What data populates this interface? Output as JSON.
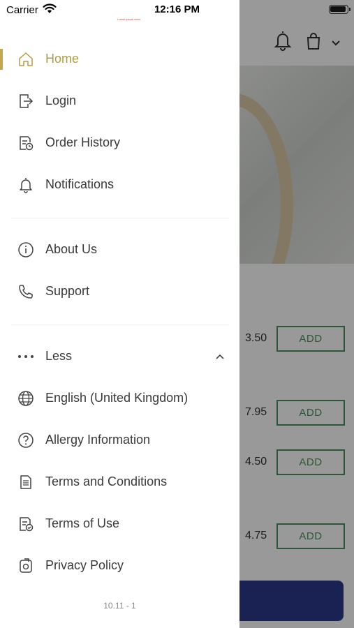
{
  "status_bar": {
    "carrier": "Carrier",
    "time": "12:16 PM"
  },
  "drawer": {
    "note": "Lorem ipsum dolor",
    "primary_items": [
      {
        "label": "Home",
        "icon": "home-icon",
        "active": true
      },
      {
        "label": "Login",
        "icon": "login-icon"
      },
      {
        "label": "Order History",
        "icon": "order-history-icon"
      },
      {
        "label": "Notifications",
        "icon": "bell-icon"
      }
    ],
    "secondary_items": [
      {
        "label": "About Us",
        "icon": "info-icon"
      },
      {
        "label": "Support",
        "icon": "phone-icon"
      }
    ],
    "toggle": {
      "label": "Less",
      "icon": "ellipsis-icon"
    },
    "more_items": [
      {
        "label": "English (United Kingdom)",
        "icon": "globe-icon"
      },
      {
        "label": "Allergy Information",
        "icon": "question-icon"
      },
      {
        "label": "Terms and Conditions",
        "icon": "document-icon"
      },
      {
        "label": "Terms of Use",
        "icon": "document-check-icon"
      },
      {
        "label": "Privacy Policy",
        "icon": "privacy-icon"
      }
    ],
    "version": "10.11 - 1"
  },
  "background": {
    "products": [
      {
        "price": "3.50",
        "button": "ADD"
      },
      {
        "price": "7.95",
        "button": "ADD"
      },
      {
        "price": "4.50",
        "button": "ADD"
      },
      {
        "price": "4.75",
        "button": "ADD"
      }
    ]
  },
  "colors": {
    "accent": "#b29c43",
    "add_green": "#4e8f5a",
    "basket_blue": "#2b3a8a"
  }
}
